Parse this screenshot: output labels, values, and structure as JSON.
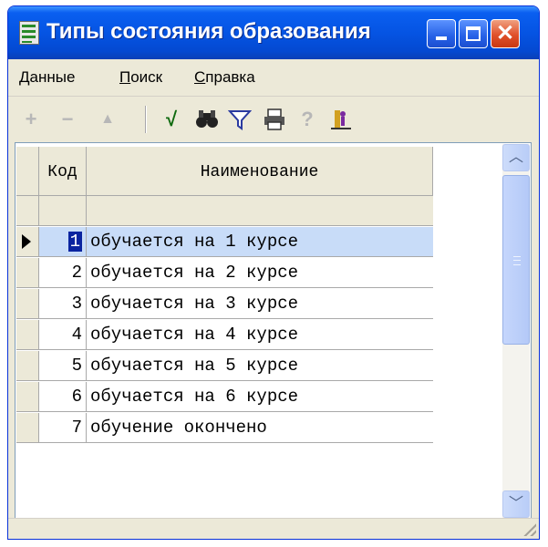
{
  "window": {
    "title": "Типы состояния образования",
    "icon": "table-app-icon",
    "controls": [
      "minimize-icon",
      "maximize-icon",
      "close-icon"
    ]
  },
  "menu": {
    "items": [
      {
        "accel": "Д",
        "rest": "анные"
      },
      {
        "accel": "П",
        "rest": "оиск"
      },
      {
        "accel": "С",
        "rest": "правка"
      }
    ]
  },
  "toolbar": {
    "icons": [
      "add-icon",
      "remove-icon",
      "move-up-icon",
      "check-icon",
      "find-icon",
      "filter-icon",
      "print-icon",
      "help-icon",
      "exit-icon"
    ]
  },
  "grid": {
    "columns": [
      "Код",
      "Наименование"
    ],
    "selected_index": 0,
    "rows": [
      {
        "code": "1",
        "name": "обучается на 1 курсе"
      },
      {
        "code": "2",
        "name": "обучается на 2 курсе"
      },
      {
        "code": "3",
        "name": "обучается на 3 курсе"
      },
      {
        "code": "4",
        "name": "обучается на 4 курсе"
      },
      {
        "code": "5",
        "name": "обучается на 5 курсе"
      },
      {
        "code": "6",
        "name": "обучается на 6 курсе"
      },
      {
        "code": "7",
        "name": "обучение окончено"
      }
    ]
  },
  "colors": {
    "titlebar": "#0554e3",
    "selected_row": "#c8dcf8",
    "selected_code_bg": "#0a24a0"
  }
}
